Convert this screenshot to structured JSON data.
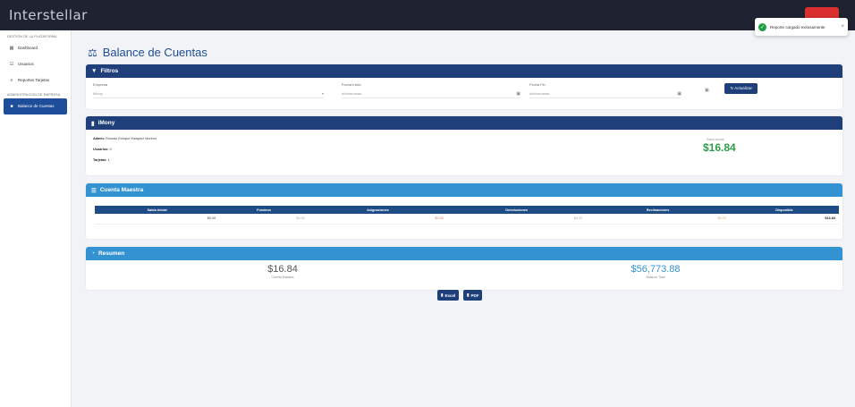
{
  "app": {
    "brand": "Interstellar"
  },
  "toast": {
    "message": "Reporte cargado exitosamente",
    "close": "×"
  },
  "sidebar": {
    "section1": "GESTIÓN DE LA PLATAFORMA",
    "section2": "ADMINISTRACIÓN DE EMPRESA",
    "items": [
      {
        "label": "Dashboard",
        "icon": "dashboard-icon"
      },
      {
        "label": "Usuarios",
        "icon": "users-icon"
      },
      {
        "label": "Reportes Tarjetas",
        "icon": "report-icon"
      },
      {
        "label": "Balance de Cuentas",
        "icon": "balance-icon"
      }
    ]
  },
  "page": {
    "title": "Balance de Cuentas"
  },
  "filters": {
    "header": "Filtros",
    "empresa_label": "Empresa",
    "empresa_value": "iMony",
    "fecha_inicio_label": "Fecha Inicio",
    "fecha_inicio_placeholder": "dd/mm/aaaa",
    "fecha_fin_label": "Fecha Fin",
    "fecha_fin_placeholder": "dd/mm/aaaa",
    "refresh_label": "Actualizar"
  },
  "company": {
    "name": "iMony",
    "admin_label": "Admin:",
    "admin_value": "Ricardo Enrique Marquez Moreno",
    "usuarios_label": "Usuarios:",
    "usuarios_value": "0",
    "tarjetas_label": "Tarjetas:",
    "tarjetas_value": "1",
    "saldo_label": "Saldo Actual",
    "saldo_value": "$16.84"
  },
  "maestra": {
    "header": "Cuenta Maestra",
    "columns": [
      "Saldo Inicial",
      "Fondeos",
      "Asignaciones",
      "Devoluciones",
      "Reclinaciones",
      "Disponible"
    ],
    "row": [
      "$0.00",
      "$0.00",
      "$0.00",
      "$0.00",
      "$0.00",
      "$16.84"
    ]
  },
  "resumen": {
    "header": "Resumen",
    "cuenta_maestra_value": "$16.84",
    "cuenta_maestra_label": "Cuenta Maestra",
    "balance_total_value": "$56,773.88",
    "balance_total_label": "Balance Total"
  },
  "export": {
    "excel_label": "Excel",
    "pdf_label": "PDF"
  },
  "colors": {
    "primary": "#1e3f7a",
    "accent": "#3392d1",
    "success": "#2e9e4a",
    "sidebar_active": "#1e4d9a"
  }
}
